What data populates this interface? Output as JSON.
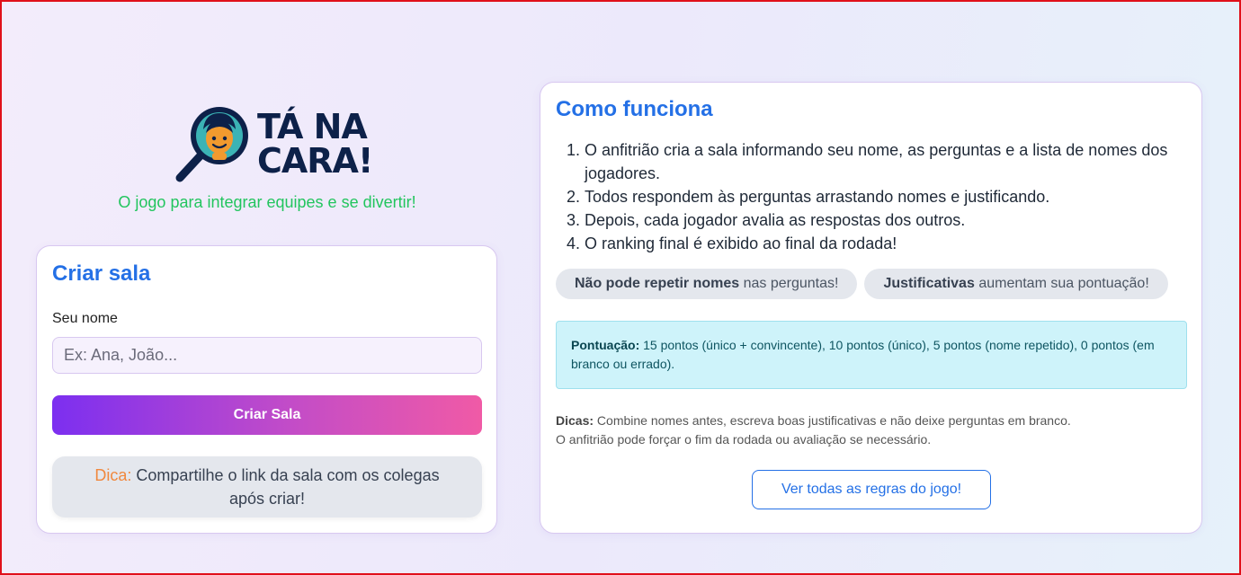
{
  "brand": {
    "logo_line1": "TÁ NA",
    "logo_line2": "CARA!",
    "tagline": "O jogo para integrar equipes e se divertir!",
    "colors": {
      "navy": "#0d2149",
      "teal": "#3bb3b5",
      "orange": "#f29a2e",
      "green": "#22c55e"
    }
  },
  "create_room": {
    "title": "Criar sala",
    "name_label": "Seu nome",
    "name_placeholder": "Ex: Ana, João...",
    "name_value": "",
    "submit_label": "Criar Sala",
    "tip_prefix": "Dica:",
    "tip_text": "Compartilhe o link da sala com os colegas após criar!"
  },
  "how_it_works": {
    "title": "Como funciona",
    "steps": [
      "O anfitrião cria a sala informando seu nome, as perguntas e a lista de nomes dos jogadores.",
      "Todos respondem às perguntas arrastando nomes e justificando.",
      "Depois, cada jogador avalia as respostas dos outros.",
      "O ranking final é exibido ao final da rodada!"
    ],
    "pills": [
      {
        "bold": "Não pode repetir nomes",
        "rest": "nas perguntas!"
      },
      {
        "bold": "Justificativas",
        "rest": "aumentam sua pontuação!"
      }
    ],
    "scoring_label": "Pontuação:",
    "scoring_text": "15 pontos (único + convincente), 10 pontos (único), 5 pontos (nome repetido), 0 pontos (em branco ou errado).",
    "hints_label": "Dicas:",
    "hints_line1": "Combine nomes antes, escreva boas justificativas e não deixe perguntas em branco.",
    "hints_line2": "O anfitrião pode forçar o fim da rodada ou avaliação se necessário.",
    "rules_button": "Ver todas as regras do jogo!"
  }
}
